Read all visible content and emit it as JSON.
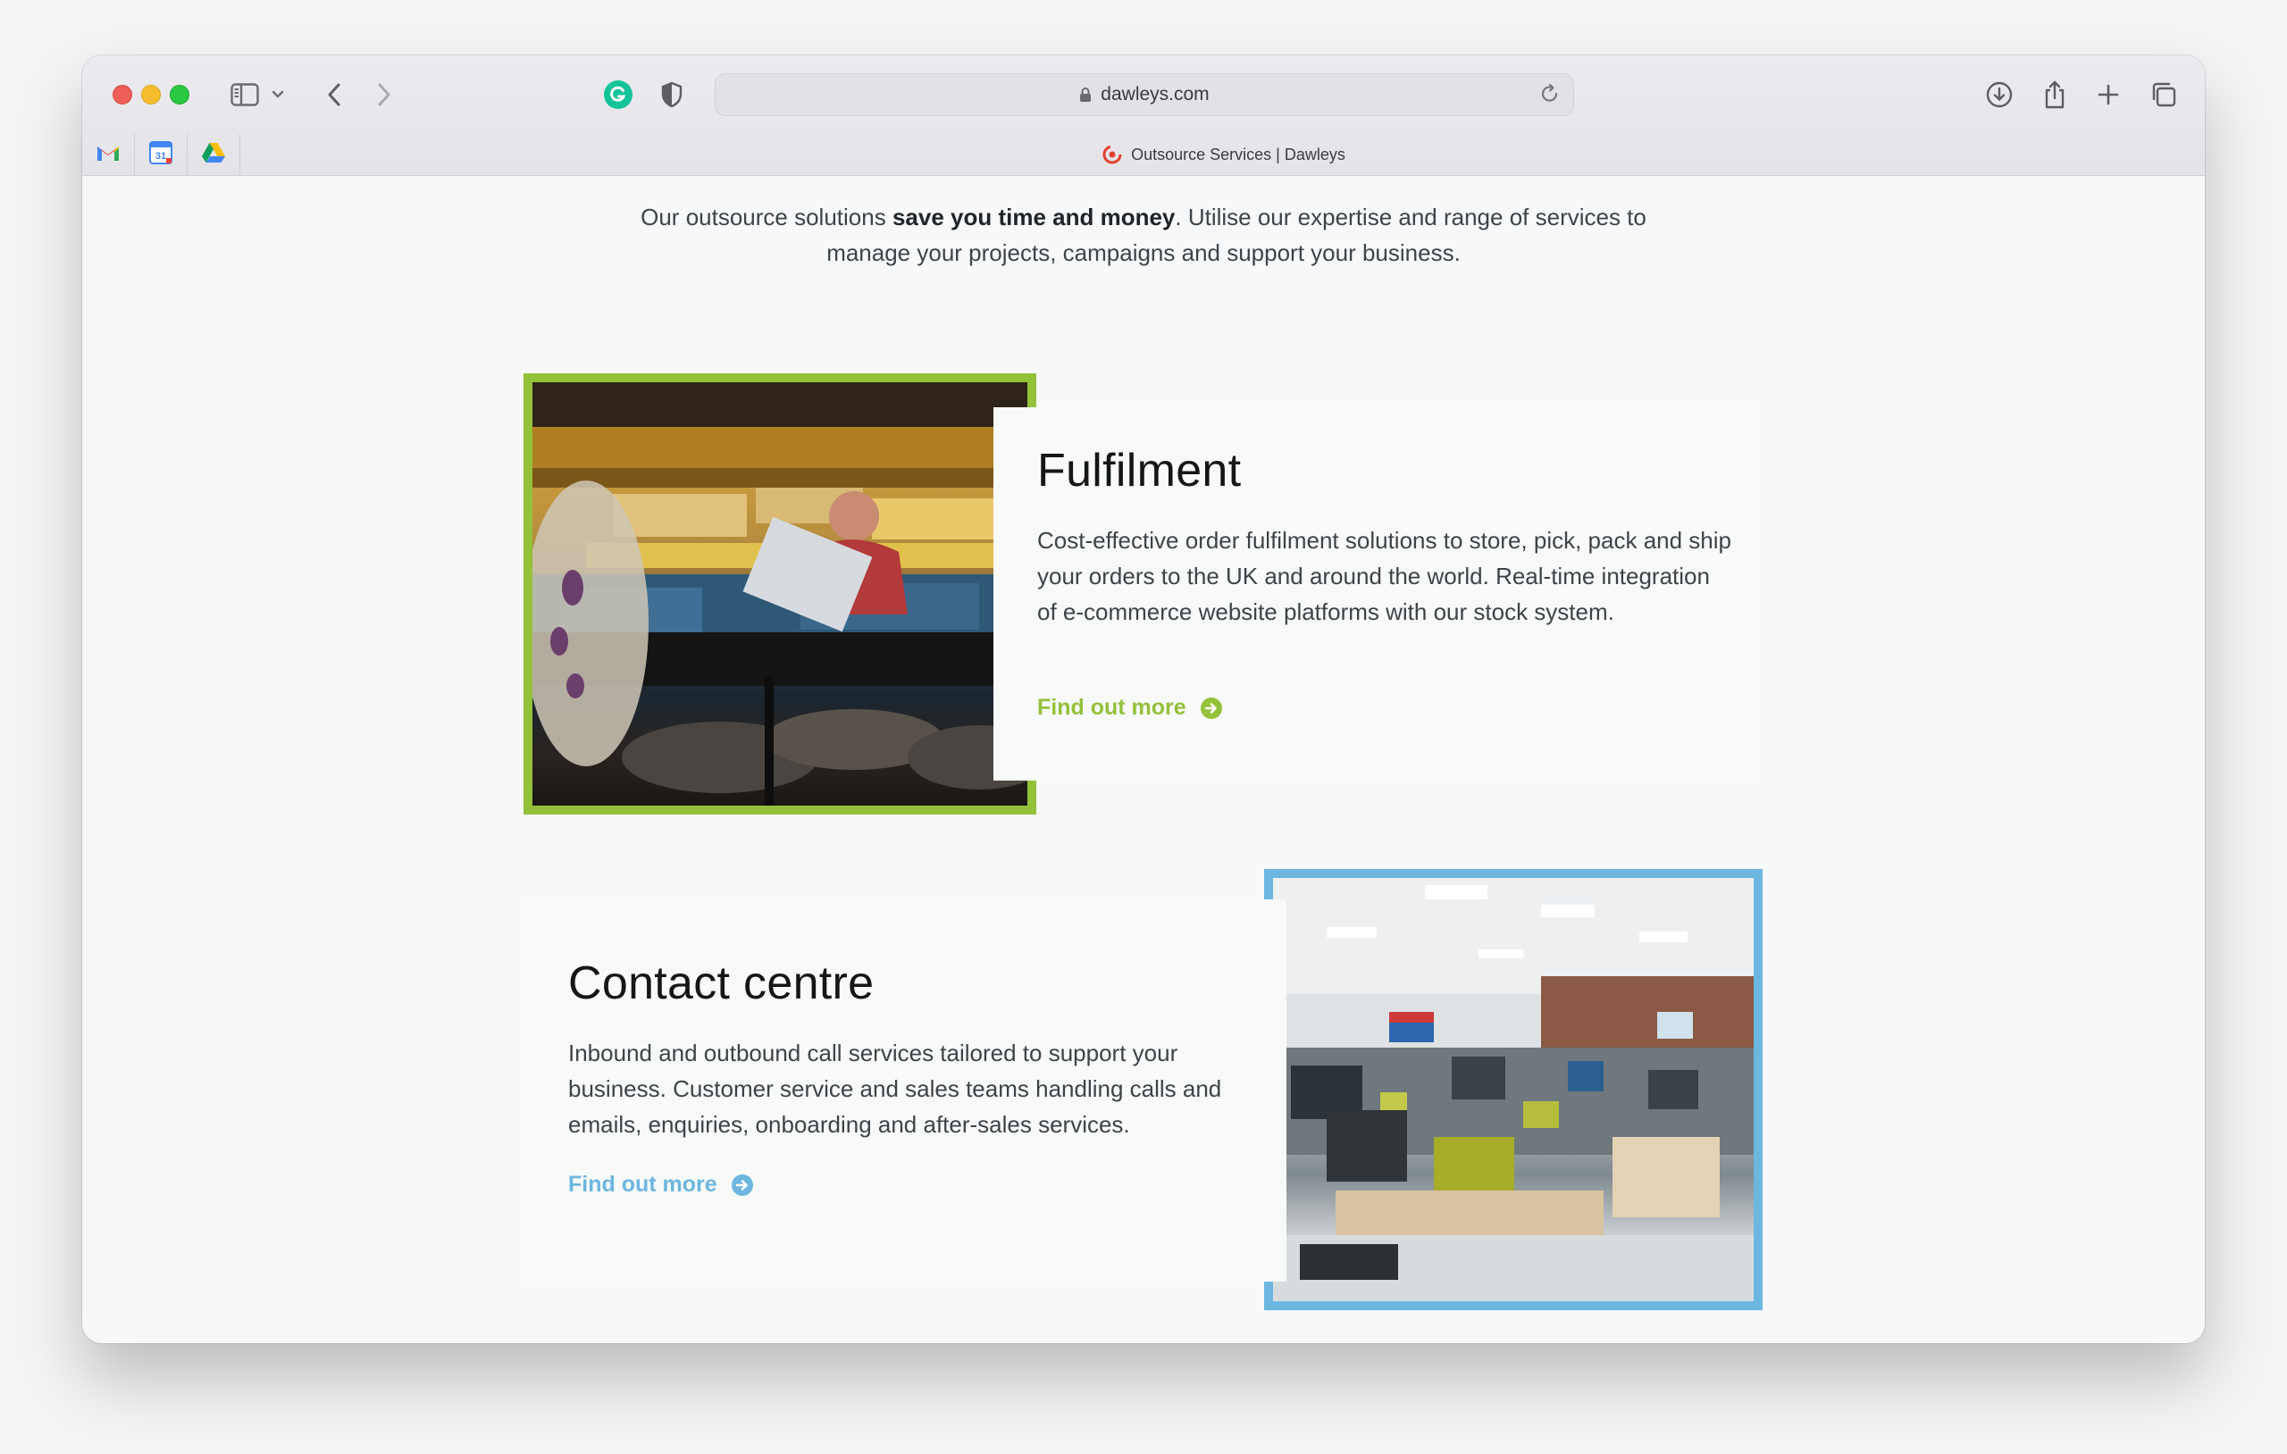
{
  "browser": {
    "url": "dawleys.com",
    "tab_title": "Outsource Services | Dawleys",
    "bookmarks": [
      {
        "name": "gmail",
        "icon": "gmail-icon"
      },
      {
        "name": "calendar",
        "icon": "calendar-icon",
        "label": "31"
      },
      {
        "name": "drive",
        "icon": "drive-icon"
      }
    ]
  },
  "intro": {
    "text_before": "Our outsource solutions ",
    "text_bold": "save you time and money",
    "text_after": ". Utilise our expertise and range of services to manage your projects, campaigns and support your business."
  },
  "services": [
    {
      "title": "Fulfilment",
      "description": "Cost-effective order fulfilment solutions to store, pick, pack and ship your orders to the UK and around the world. Real-time integration of e-commerce website platforms with our stock system.",
      "link_label": "Find out more",
      "accent_color": "#93c13a"
    },
    {
      "title": "Contact centre",
      "description": "Inbound and outbound call services tailored to support your business. Customer service and sales teams handling calls and emails, enquiries, onboarding and after-sales services.",
      "link_label": "Find out more",
      "accent_color": "#6cb6e0"
    }
  ]
}
